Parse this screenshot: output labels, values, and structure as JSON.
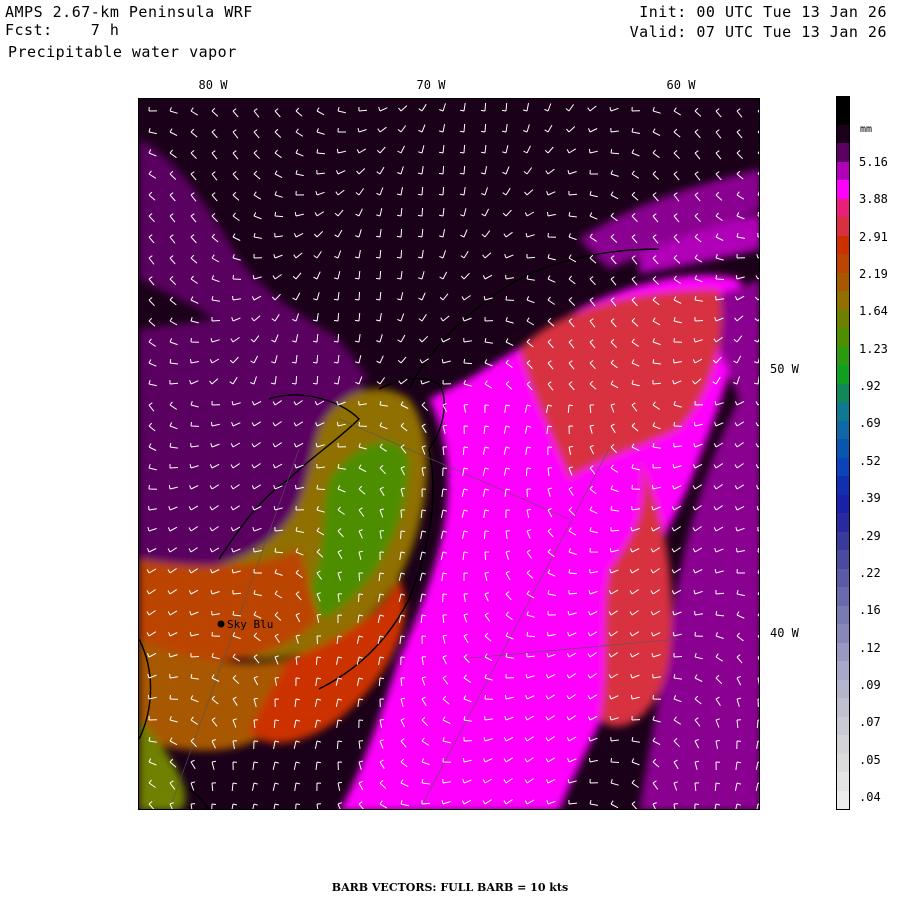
{
  "header": {
    "model": "AMPS 2.67-km Peninsula WRF",
    "fcst_label": "Fcst:",
    "fcst_value": "7 h",
    "field": "Precipitable water vapor",
    "init": "Init: 00 UTC Tue 13 Jan 26",
    "valid": "Valid: 07 UTC Tue 13 Jan 26"
  },
  "map": {
    "lon_labels": [
      "80 W",
      "70 W",
      "60 W"
    ],
    "lat_labels": [
      "50 W",
      "40 W"
    ],
    "station": "Sky Blu"
  },
  "colorbar": {
    "unit": "mm",
    "labels": [
      "5.16",
      "3.88",
      "2.91",
      "2.19",
      "1.64",
      "1.23",
      ".92",
      ".69",
      ".52",
      ".39",
      ".29",
      ".22",
      ".16",
      ".12",
      ".09",
      ".07",
      ".05",
      ".04"
    ],
    "colors": [
      "#1a0018",
      "#5a0060",
      "#b000b8",
      "#ff00ff",
      "#e8207a",
      "#d83040",
      "#cc3000",
      "#bb4400",
      "#a85800",
      "#907000",
      "#6f8000",
      "#4e8e00",
      "#2a9a10",
      "#10a020",
      "#108858",
      "#107890",
      "#1068a8",
      "#0a55b0",
      "#0a44b8",
      "#1030b0",
      "#1a20a8",
      "#2a2aa0",
      "#3a3a9a",
      "#4a4aa0",
      "#5a5aa6",
      "#6a6aac",
      "#7a7ab2",
      "#8888b8",
      "#9898c0",
      "#a8a8c8",
      "#b4b4cc",
      "#c0c0d0",
      "#cacad4",
      "#d4d4d8",
      "#dcdcdc",
      "#e4e4e4",
      "#ececec"
    ]
  },
  "footer": "BARB VECTORS:  FULL BARB = 10 kts"
}
